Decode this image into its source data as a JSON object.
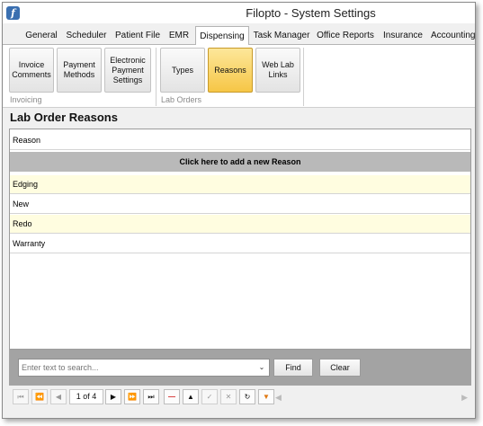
{
  "app": {
    "title": "Filopto - System Settings",
    "icon": "filopto-app-icon"
  },
  "tabs": [
    {
      "label": "General"
    },
    {
      "label": "Scheduler"
    },
    {
      "label": "Patient File"
    },
    {
      "label": "EMR"
    },
    {
      "label": "Dispensing",
      "active": true
    },
    {
      "label": "Task Manager"
    },
    {
      "label": "Office Reports"
    },
    {
      "label": "Insurance"
    },
    {
      "label": "Accounting"
    }
  ],
  "ribbon": {
    "invoicing": {
      "group_label": "Invoicing",
      "buttons": [
        {
          "label": "Invoice\nComments"
        },
        {
          "label": "Payment\nMethods"
        },
        {
          "label": "Electronic\nPayment\nSettings"
        }
      ]
    },
    "lab_orders": {
      "group_label": "Lab Orders",
      "buttons": [
        {
          "label": "Types"
        },
        {
          "label": "Reasons",
          "selected": true
        },
        {
          "label": "Web Lab\nLinks"
        }
      ]
    }
  },
  "section": {
    "title": "Lab Order Reasons"
  },
  "grid": {
    "column_header": "Reason",
    "add_row_label": "Click here to add a new Reason",
    "rows": [
      "Edging",
      "New",
      "Redo",
      "Warranty"
    ]
  },
  "search": {
    "placeholder": "Enter text to search...",
    "find_label": "Find",
    "clear_label": "Clear"
  },
  "navigator": {
    "page_text": "1 of 4",
    "buttons": [
      "first-icon",
      "prev-page-icon",
      "prev-icon",
      "next-icon",
      "next-page-icon",
      "last-icon",
      "delete-icon",
      "move-up-icon",
      "save-icon",
      "cancel-icon",
      "refresh-icon",
      "filter-icon"
    ]
  },
  "colors": {
    "selected_button": "#f6c646",
    "alt_row": "#fffde0",
    "add_row_bar": "#b9b9b9"
  }
}
